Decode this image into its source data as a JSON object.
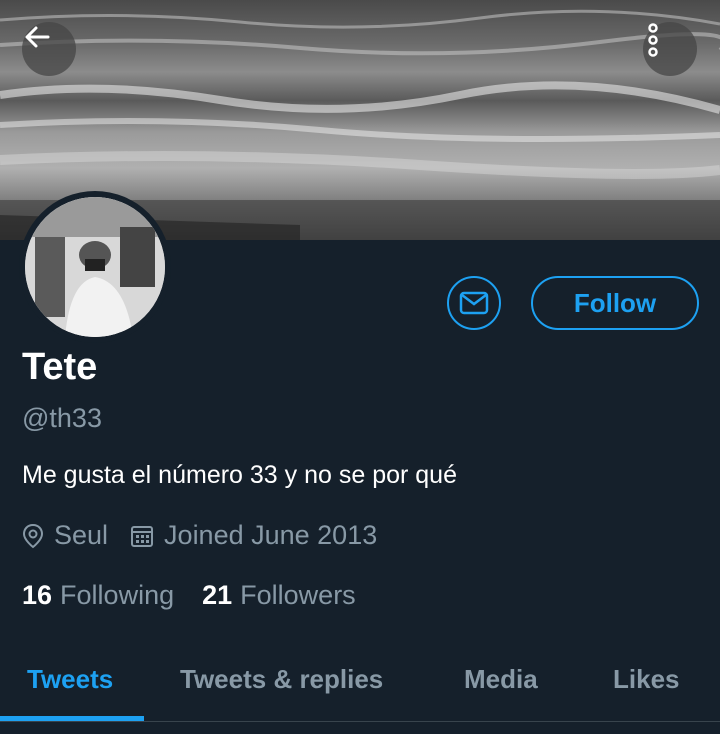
{
  "header": {
    "back_icon": "arrow-left-icon",
    "more_icon": "more-vertical-icon"
  },
  "profile": {
    "name": "Tete",
    "handle": "@th33",
    "bio": "Me gusta el número 33 y no se por qué",
    "location": "Seul",
    "joined": "Joined June 2013",
    "following_count": "16",
    "following_label": "Following",
    "followers_count": "21",
    "followers_label": "Followers"
  },
  "actions": {
    "message_icon": "envelope-icon",
    "follow_label": "Follow"
  },
  "tabs": [
    {
      "label": "Tweets",
      "active": true
    },
    {
      "label": "Tweets & replies",
      "active": false
    },
    {
      "label": "Media",
      "active": false
    },
    {
      "label": "Likes",
      "active": false
    }
  ],
  "colors": {
    "background": "#15202b",
    "accent": "#1da1f2",
    "secondary_text": "#8899a6"
  }
}
